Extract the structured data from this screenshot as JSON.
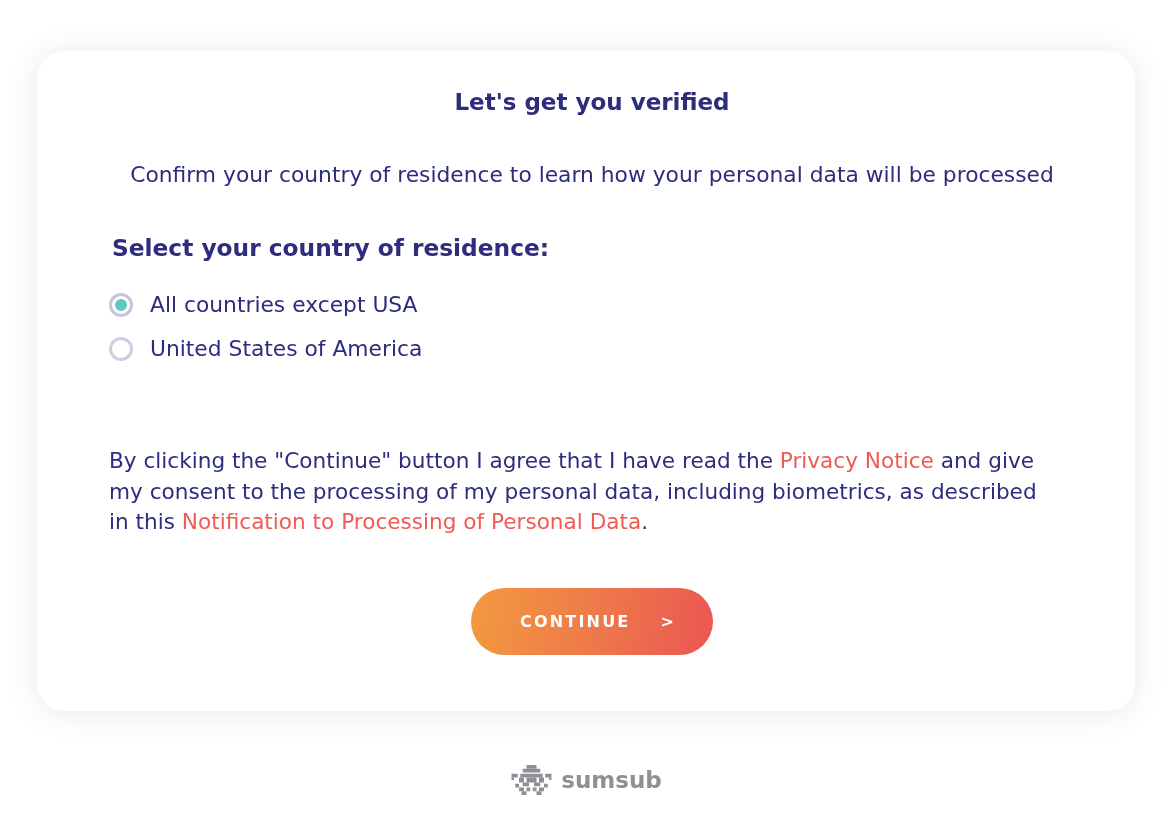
{
  "title": "Let's get you verified",
  "subtitle": "Confirm your country of residence to learn how your personal data will be processed",
  "country_question": "Select your country of residence:",
  "countries": [
    {
      "label": "All countries except USA",
      "selected": true
    },
    {
      "label": "United States of America",
      "selected": false
    }
  ],
  "consent": [
    {
      "kind": "text",
      "text": "By clicking the \"Continue\" button I agree that I have read the "
    },
    {
      "kind": "link",
      "text": "Privacy Notice"
    },
    {
      "kind": "text",
      "text": " and give my consent to the processing of my personal data, including biometrics, as described in this "
    },
    {
      "kind": "link",
      "text": "Notification to Processing of Personal Data"
    },
    {
      "kind": "text",
      "text": "."
    }
  ],
  "button": {
    "label": "CONTINUE",
    "arrow": ">"
  },
  "footer": {
    "brand": "sumsub"
  }
}
